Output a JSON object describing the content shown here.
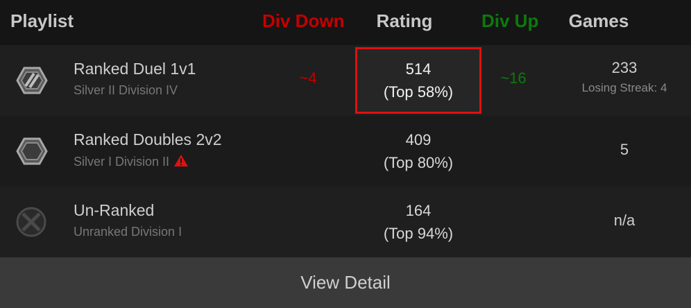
{
  "header": {
    "playlist": "Playlist",
    "div_down": "Div Down",
    "rating": "Rating",
    "div_up": "Div Up",
    "games": "Games"
  },
  "colors": {
    "div_down": "#c40000",
    "div_up": "#0c7a0c",
    "highlight_border": "#e01010",
    "warning": "#e01010"
  },
  "rows": [
    {
      "icon": "silver-rank-icon",
      "name": "Ranked Duel 1v1",
      "division": "Silver II Division IV",
      "div_down": "~4",
      "rating": "514",
      "top": "(Top 58%)",
      "div_up": "~16",
      "games": "233",
      "streak": "Losing Streak: 4"
    },
    {
      "icon": "silver-rank-icon",
      "name": "Ranked Doubles 2v2",
      "division": "Silver I Division II",
      "warning_icon": "warning-icon",
      "rating": "409",
      "top": "(Top 80%)",
      "games": "5"
    },
    {
      "icon": "unranked-icon",
      "name": "Un-Ranked",
      "division": "Unranked Division I",
      "rating": "164",
      "top": "(Top 94%)",
      "games": "n/a"
    }
  ],
  "footer": {
    "view_detail": "View Detail"
  }
}
